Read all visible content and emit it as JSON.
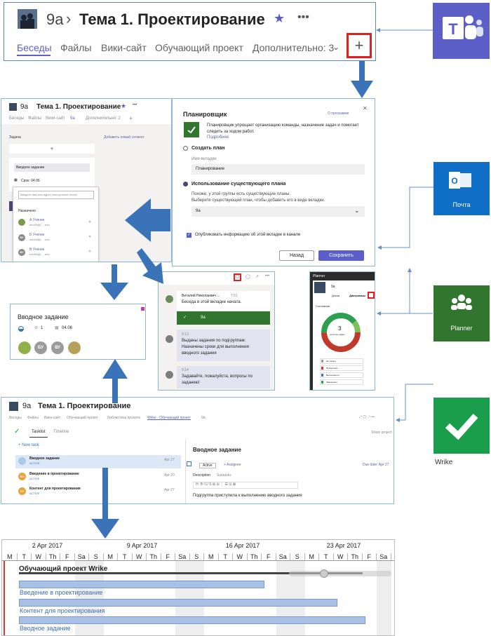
{
  "teams_header": {
    "team": "9a",
    "channel": "Тема 1. Проектирование",
    "tabs": [
      "Беседы",
      "Файлы",
      "Вики-сайт",
      "Обучающий проект",
      "Дополнительно: 3"
    ],
    "more": "•••"
  },
  "planner_dialog": {
    "title": "Планировщик",
    "about": "О программе",
    "description": "Планировщик упрощает организацию команды, назначение задач и помогает следить за ходом работ.",
    "details": "Подробнее",
    "option_create": "Создать план",
    "tab_name_label": "Имя вкладки",
    "tab_name_value": "Планирование",
    "option_existing": "Использование существующего плана",
    "existing_note_1": "Похоже, у этой группы есть существующие планы.",
    "existing_note_2": "Выберите существующий план, чтобы добавить его в виде вкладки.",
    "select_value": "9а",
    "publish": "Опубликовать информацию об этой вкладке в канале",
    "back": "Назад",
    "save": "Сохранить"
  },
  "mini_teams": {
    "team": "9a",
    "channel": "Тема 1. Проектирование",
    "tabs": [
      "Беседы",
      "Файлы",
      "Вики-сайт",
      "9a",
      "Дополнительно: 2"
    ],
    "task_col": "Задача",
    "add_segment": "Добавить новый сегмент",
    "task_name": "Вводное задание",
    "due": "Срок: 04.06",
    "email_placeholder": "Введите имя или адрес электронной почты",
    "assigned": "Назначено",
    "people": [
      {
        "initials": "",
        "name": "А Ученик",
        "mail": "edu40@(... .edu"
      },
      {
        "initials": "БУ",
        "name": "Б Ученик",
        "mail": "edu43@(... .edu"
      },
      {
        "initials": "ВУ",
        "name": "В Ученик",
        "mail": "edu90@(... .edu"
      }
    ]
  },
  "task_card": {
    "title": "Вводное задание",
    "checklist": "1",
    "date": "04.06",
    "avatars": [
      "",
      "БУ",
      "ВУ",
      ""
    ]
  },
  "chat": {
    "author": "Виталий Николаевич ...",
    "time": "7:51",
    "message": "Беседа в этой вкладке начата.",
    "card_label": "9a",
    "msg2_time": "9:13",
    "msg2": "Выданы задания по подгруппам. Назначены сроки для выполнения вводного задания",
    "msg3_time": "9:14",
    "msg3": "Задавайте, пожалуйста, вопросы по заданию!"
  },
  "planner_app": {
    "title": "Planner",
    "chart_center": "3",
    "chart_sub": "осталось задач",
    "chart_label": "Состояние",
    "legend": [
      "Не начато",
      "Просрочено",
      "Выполняется",
      "Завершено"
    ],
    "tabs": [
      "Доска",
      "Диаграммы"
    ]
  },
  "wrike_header": {
    "team": "9a",
    "channel": "Тема 1. Проектирование",
    "tabs": [
      "Беседы",
      "Файлы",
      "Вики-сайт",
      "Обучающий проект",
      "Библиотека проекта",
      "Wrike - Обучающий проект",
      "9a"
    ],
    "subtabs": [
      "Tasklist",
      "Timeline"
    ],
    "share": "Share project",
    "new_task": "+ New task",
    "tasks": [
      {
        "badge": "",
        "name": "Вводное задание",
        "status": "ACTIVE",
        "date": "Apr 27"
      },
      {
        "badge": "ВН",
        "name": "Введение в проектирование",
        "status": "ACTIVE",
        "date": "Apr 20"
      },
      {
        "badge": "ПУ",
        "name": "Контент для проектирования",
        "status": "ACTIVE",
        "date": "Apr 27"
      }
    ],
    "detail_title": "Вводное задание",
    "detail_status": "Active",
    "assignee": "+ Assignee",
    "due": "Due date: Apr 27",
    "detail_tabs": [
      "Description",
      "Subtasks"
    ],
    "detail_text": "Подгруппа приступила к выполнению вводного задания"
  },
  "gantt": {
    "weeks": [
      "2 Apr 2017",
      "9 Apr 2017",
      "16 Apr 2017",
      "23 Apr 2017"
    ],
    "days": [
      "M",
      "T",
      "W",
      "Th",
      "F",
      "Sa",
      "S",
      "M",
      "T",
      "W",
      "Th",
      "F",
      "Sa",
      "S",
      "M",
      "T",
      "W",
      "Th",
      "F",
      "Sa",
      "S",
      "M",
      "T",
      "W",
      "Th",
      "F",
      "Sa"
    ],
    "project": "Обучающий проект Wrike",
    "rows": [
      "Введение в проектирование",
      "Контент для проектирования",
      "Вводное задание"
    ]
  },
  "apps": {
    "teams": "Microsoft Teams",
    "outlook": "Почта",
    "planner": "Planner",
    "wrike": "Wrike"
  },
  "colors": {
    "teams": "#5b5fc7",
    "outlook": "#0f6fc6",
    "planner": "#31752f",
    "wrike": "#1a9e4b",
    "arrow": "#3b73b8",
    "highlight": "#e02020"
  }
}
